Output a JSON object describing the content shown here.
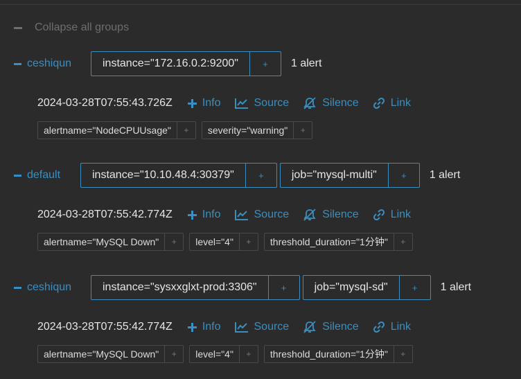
{
  "collapse_all_label": "Collapse all groups",
  "colors": {
    "accent": "#3a8fc0",
    "background": "#2b2b2b",
    "muted": "#6e6e6e",
    "text": "#e6e6e6"
  },
  "actions": {
    "info": "Info",
    "source": "Source",
    "silence": "Silence",
    "link": "Link"
  },
  "groups": [
    {
      "name": "ceshiqun",
      "labels": [
        "instance=\"172.16.0.2:9200\""
      ],
      "count": "1 alert",
      "alert": {
        "timestamp": "2024-03-28T07:55:43.726Z",
        "labels": [
          "alertname=\"NodeCPUUsage\"",
          "severity=\"warning\""
        ]
      }
    },
    {
      "name": "default",
      "labels": [
        "instance=\"10.10.48.4:30379\"",
        "job=\"mysql-multi\""
      ],
      "count": "1 alert",
      "alert": {
        "timestamp": "2024-03-28T07:55:42.774Z",
        "labels": [
          "alertname=\"MySQL Down\"",
          "level=\"4\"",
          "threshold_duration=\"1分钟\""
        ]
      }
    },
    {
      "name": "ceshiqun",
      "labels": [
        "instance=\"sysxxglxt-prod:3306\"",
        "job=\"mysql-sd\""
      ],
      "count": "1 alert",
      "alert": {
        "timestamp": "2024-03-28T07:55:42.774Z",
        "labels": [
          "alertname=\"MySQL Down\"",
          "level=\"4\"",
          "threshold_duration=\"1分钟\""
        ]
      }
    }
  ]
}
